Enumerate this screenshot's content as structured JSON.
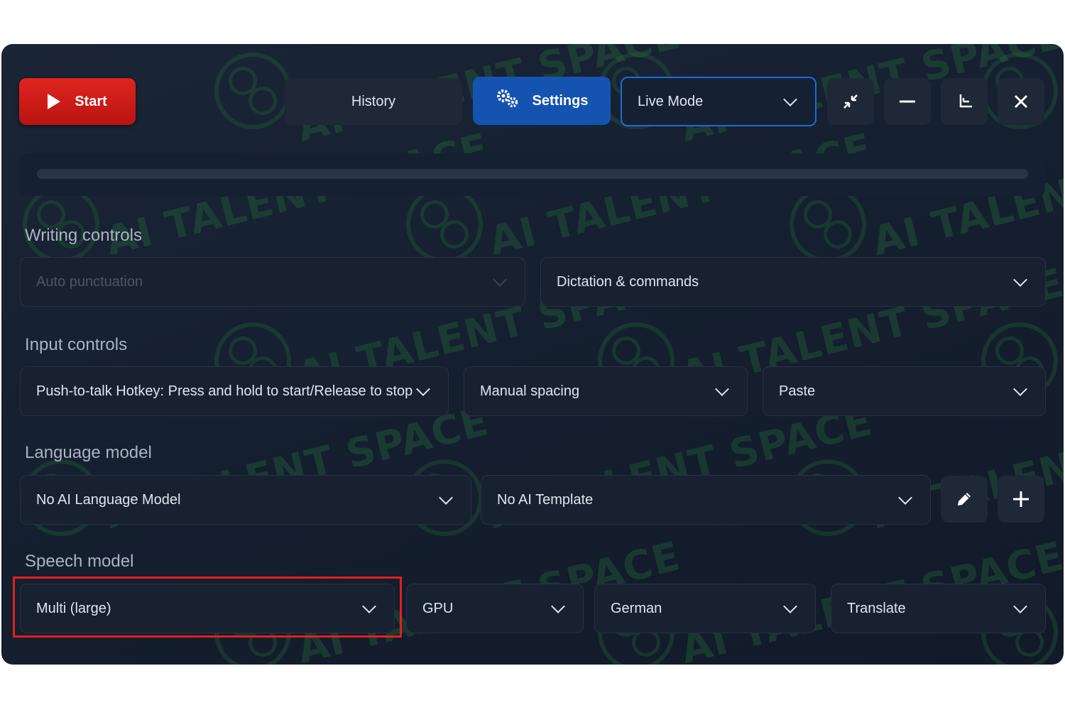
{
  "toolbar": {
    "start_label": "Start",
    "history_label": "History",
    "settings_label": "Settings",
    "mode_selected": "Live Mode"
  },
  "watermark": "AI TALENT SPACE",
  "progress": {
    "value": 0
  },
  "sections": {
    "writing": {
      "title": "Writing controls",
      "punctuation": "Auto punctuation",
      "dictation": "Dictation & commands"
    },
    "input": {
      "title": "Input controls",
      "hotkey": "Push-to-talk Hotkey: Press and hold to start/Release to stop",
      "spacing": "Manual spacing",
      "output": "Paste"
    },
    "language": {
      "title": "Language model",
      "model": "No AI Language Model",
      "template": "No AI Template"
    },
    "speech": {
      "title": "Speech model",
      "model": "Multi (large)",
      "device": "GPU",
      "language": "German",
      "task": "Translate"
    }
  },
  "colors": {
    "start": "#d21d18",
    "settings": "#1553b0",
    "highlight": "#e21f1f",
    "background": "#152030"
  }
}
